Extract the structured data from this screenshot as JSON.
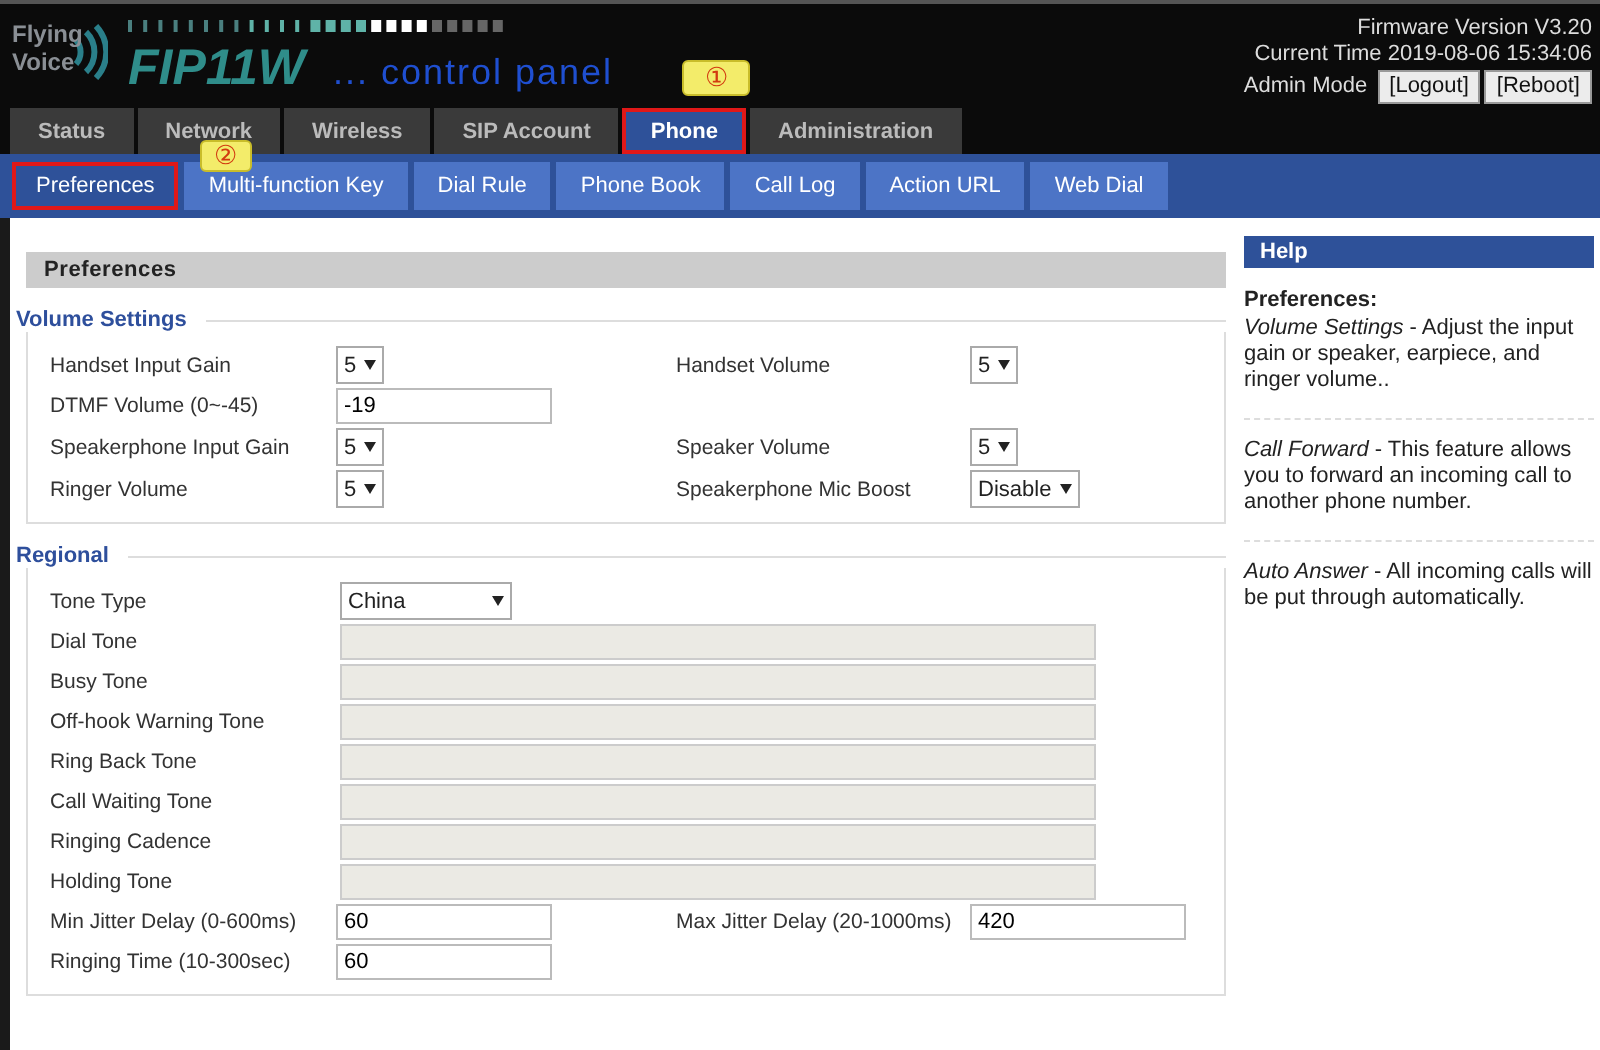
{
  "header": {
    "brand_top": "Flying",
    "brand_bottom": "Voice",
    "model": "FIP11W",
    "subtitle": "... control panel",
    "firmware": "Firmware Version V3.20",
    "time": "Current Time 2019-08-06 15:34:06",
    "mode": "Admin Mode",
    "buttons": [
      "[Logout]",
      "[Reboot]"
    ]
  },
  "tabs": [
    {
      "label": "Status",
      "selected": false,
      "marked": false
    },
    {
      "label": "Network",
      "selected": false,
      "marked": false
    },
    {
      "label": "Wireless",
      "selected": false,
      "marked": false
    },
    {
      "label": "SIP Account",
      "selected": false,
      "marked": false
    },
    {
      "label": "Phone",
      "selected": true,
      "marked": true,
      "callout": "①"
    },
    {
      "label": "Administration",
      "selected": false,
      "marked": false
    }
  ],
  "subtabs": [
    {
      "label": "Preferences",
      "selected": true,
      "marked": true,
      "callout": "②"
    },
    {
      "label": "Multi-function Key",
      "selected": false,
      "marked": false
    },
    {
      "label": "Dial Rule",
      "selected": false,
      "marked": false
    },
    {
      "label": "Phone Book",
      "selected": false,
      "marked": false
    },
    {
      "label": "Call Log",
      "selected": false,
      "marked": false
    },
    {
      "label": "Action URL",
      "selected": false,
      "marked": false
    },
    {
      "label": "Web Dial",
      "selected": false,
      "marked": false
    }
  ],
  "page_title": "Preferences",
  "sections": [
    {
      "legend": "Volume Settings",
      "rows": [
        {
          "left": {
            "label": "Handset Input Gain",
            "kind": "select",
            "value": "5"
          },
          "right": {
            "label": "Handset Volume",
            "kind": "select",
            "value": "5"
          }
        },
        {
          "left": {
            "label": "DTMF Volume (0~-45)",
            "kind": "input",
            "value": "-19"
          }
        },
        {
          "left": {
            "label": "Speakerphone Input Gain",
            "kind": "select",
            "value": "5"
          },
          "right": {
            "label": "Speaker Volume",
            "kind": "select",
            "value": "5"
          }
        },
        {
          "left": {
            "label": "Ringer Volume",
            "kind": "select",
            "value": "5"
          },
          "right": {
            "label": "Speakerphone Mic Boost",
            "kind": "select",
            "value": "Disable"
          }
        }
      ]
    },
    {
      "legend": "Regional",
      "rows": [
        {
          "left": {
            "label": "Tone Type",
            "kind": "select",
            "value": "China",
            "wide": true
          }
        },
        {
          "left": {
            "label": "Dial Tone",
            "kind": "tone",
            "disabled": true
          }
        },
        {
          "left": {
            "label": "Busy Tone",
            "kind": "tone",
            "disabled": true
          }
        },
        {
          "left": {
            "label": "Off-hook Warning Tone",
            "kind": "tone",
            "disabled": true
          }
        },
        {
          "left": {
            "label": "Ring Back Tone",
            "kind": "tone",
            "disabled": true
          }
        },
        {
          "left": {
            "label": "Call Waiting Tone",
            "kind": "tone",
            "disabled": true
          }
        },
        {
          "left": {
            "label": "Ringing Cadence",
            "kind": "tone",
            "disabled": true
          }
        },
        {
          "left": {
            "label": "Holding Tone",
            "kind": "tone",
            "disabled": true
          }
        },
        {
          "left": {
            "label": "Min Jitter Delay (0-600ms)",
            "kind": "input",
            "value": "60"
          },
          "right": {
            "label": "Max Jitter Delay (20-1000ms)",
            "kind": "input",
            "value": "420"
          }
        },
        {
          "left": {
            "label": "Ringing Time (10-300sec)",
            "kind": "input",
            "value": "60"
          }
        }
      ]
    }
  ],
  "help": {
    "title": "Help",
    "heading": "Preferences:",
    "entries": [
      "*Volume Settings* - Adjust the input gain or speaker, earpiece, and ringer volume..",
      "*Call Forward* - This feature allows you to forward an incoming call to another phone number.",
      "*Auto Answer* - All incoming calls will be put through automatically."
    ]
  }
}
